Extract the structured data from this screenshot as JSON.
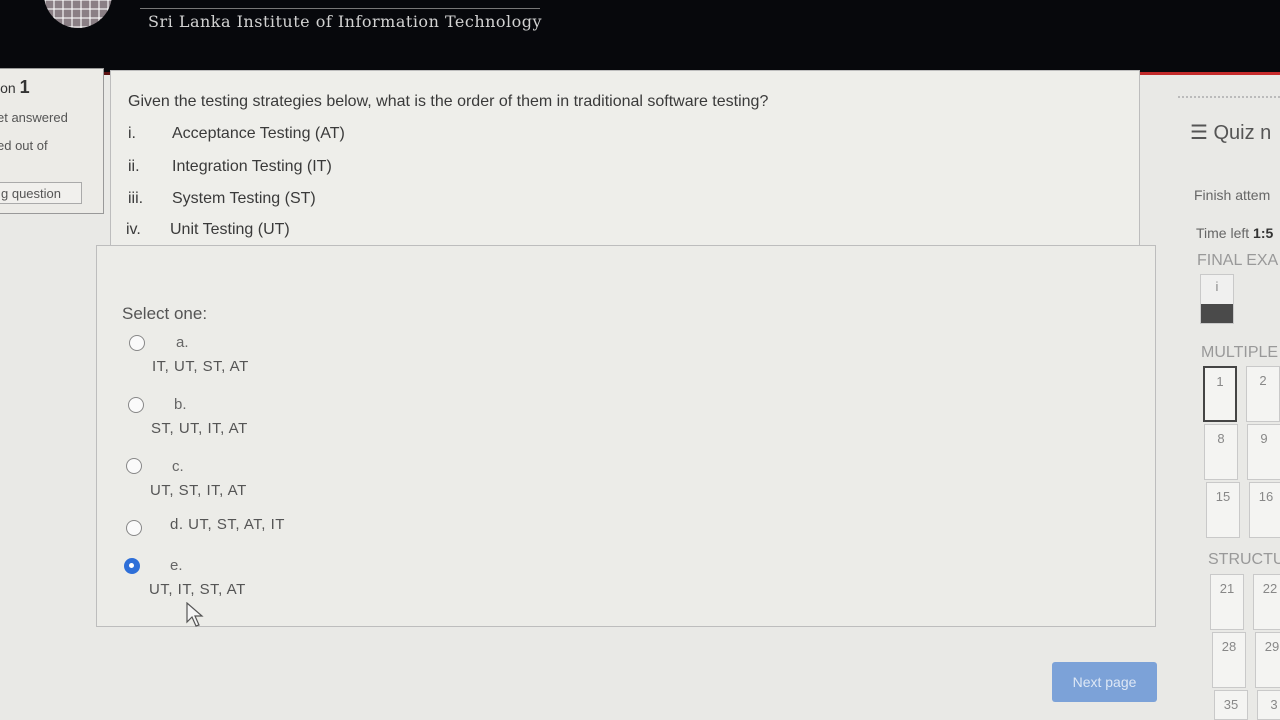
{
  "header": {
    "institute": "Sri Lanka Institute of Information Technology"
  },
  "question_info": {
    "label": "ion",
    "number": "1",
    "status": "et answered",
    "marks": "ed out of",
    "flag": "g question"
  },
  "question": {
    "text": "Given the testing strategies below, what is the order of them in traditional software testing?",
    "strategies": [
      {
        "num": "i.",
        "text": "Acceptance Testing (AT)"
      },
      {
        "num": "ii.",
        "text": "Integration Testing (IT)"
      },
      {
        "num": "iii.",
        "text": "System Testing (ST)"
      },
      {
        "num": "iv.",
        "text": "Unit Testing (UT)"
      }
    ],
    "prompt": "Select one:",
    "options": [
      {
        "letter": "a.",
        "text": "IT, UT, ST, AT",
        "selected": false
      },
      {
        "letter": "b.",
        "text": "ST, UT, IT, AT",
        "selected": false
      },
      {
        "letter": "c.",
        "text": "UT, ST, IT, AT",
        "selected": false
      },
      {
        "letter": "",
        "text": "d. UT, ST, AT, IT",
        "selected": false
      },
      {
        "letter": "e.",
        "text": "UT, IT, ST, AT",
        "selected": true
      }
    ]
  },
  "quiz_nav": {
    "title": "☰ Quiz n",
    "finish": "Finish attem",
    "time_label": "Time left ",
    "time_value": "1:5",
    "sections": [
      "FINAL EXA",
      "MULTIPLE",
      "STRUCTU"
    ],
    "info_tile": "i",
    "buttons": [
      "1",
      "2",
      "8",
      "9",
      "15",
      "16",
      "21",
      "22",
      "28",
      "29",
      "35",
      "3"
    ]
  },
  "next_button": "Next page",
  "colors": {
    "header_bg": "#07080c",
    "accent_line": "#c82c2c",
    "radio_checked": "#2e6fd8",
    "next_button": "#7ca2d8"
  }
}
